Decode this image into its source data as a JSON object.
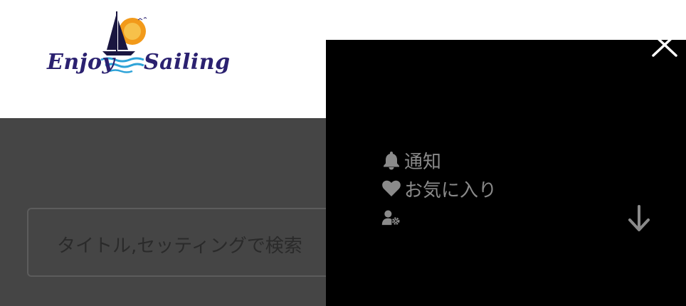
{
  "header": {
    "logo": {
      "word_left": "Enjoy",
      "word_right": "Sailing"
    }
  },
  "search": {
    "placeholder": "タイトル,セッティングで検索"
  },
  "drawer": {
    "close_icon": "close-icon",
    "items": [
      {
        "icon": "bell-icon",
        "label": "通知"
      },
      {
        "icon": "heart-icon",
        "label": "お気に入り"
      },
      {
        "icon": "user-settings-icon",
        "label": ""
      }
    ],
    "scroll_icon": "arrow-down-icon"
  },
  "colors": {
    "overlay": "#454545",
    "drawer_bg": "#000000",
    "menu_text": "#8a8a8a",
    "logo_text": "#2b2170"
  }
}
